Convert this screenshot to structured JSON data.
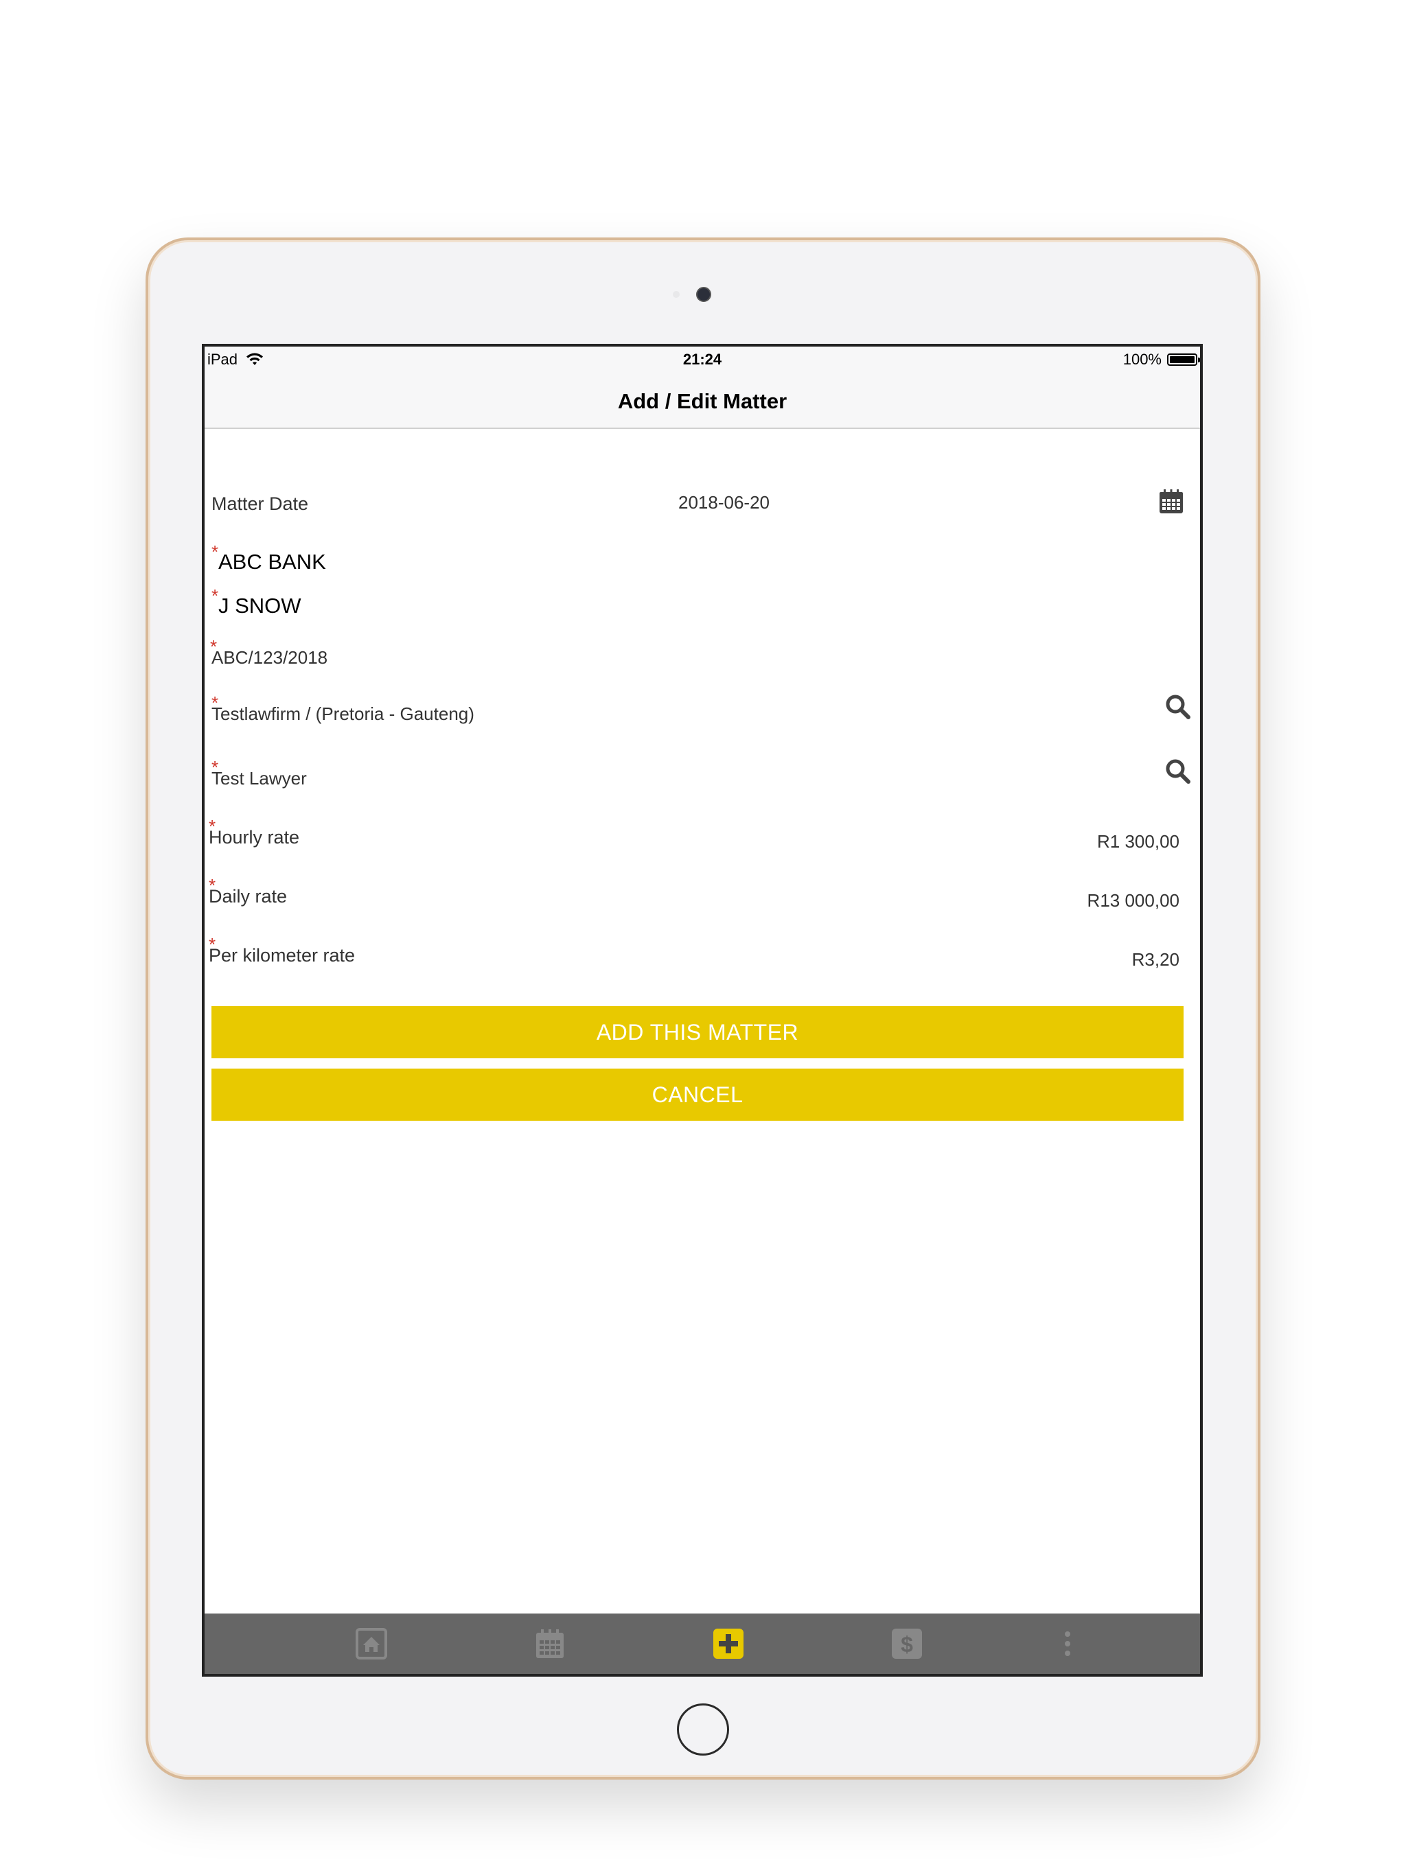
{
  "status_bar": {
    "carrier": "iPad",
    "time": "21:24",
    "battery": "100%"
  },
  "nav": {
    "title": "Add / Edit Matter"
  },
  "form": {
    "matter_date_label": "Matter Date",
    "matter_date_value": "2018-06-20",
    "client": "ABC BANK",
    "contact": "J SNOW",
    "reference": "ABC/123/2018",
    "law_firm": "Testlawfirm / (Pretoria - Gauteng)",
    "lawyer": "Test Lawyer",
    "hourly_rate_label": "Hourly rate",
    "hourly_rate_value": "R1 300,00",
    "daily_rate_label": "Daily rate",
    "daily_rate_value": "R13 000,00",
    "km_rate_label": "Per kilometer rate",
    "km_rate_value": "R3,20",
    "required_mark": "*"
  },
  "buttons": {
    "add": "ADD THIS MATTER",
    "cancel": "CANCEL"
  },
  "tabs": [
    {
      "icon": "home-icon"
    },
    {
      "icon": "calendar-icon"
    },
    {
      "icon": "add-icon"
    },
    {
      "icon": "dollar-icon"
    },
    {
      "icon": "more-icon"
    }
  ],
  "colors": {
    "accent": "#e8c900",
    "tabbar": "#666666",
    "required": "#d0372c"
  }
}
